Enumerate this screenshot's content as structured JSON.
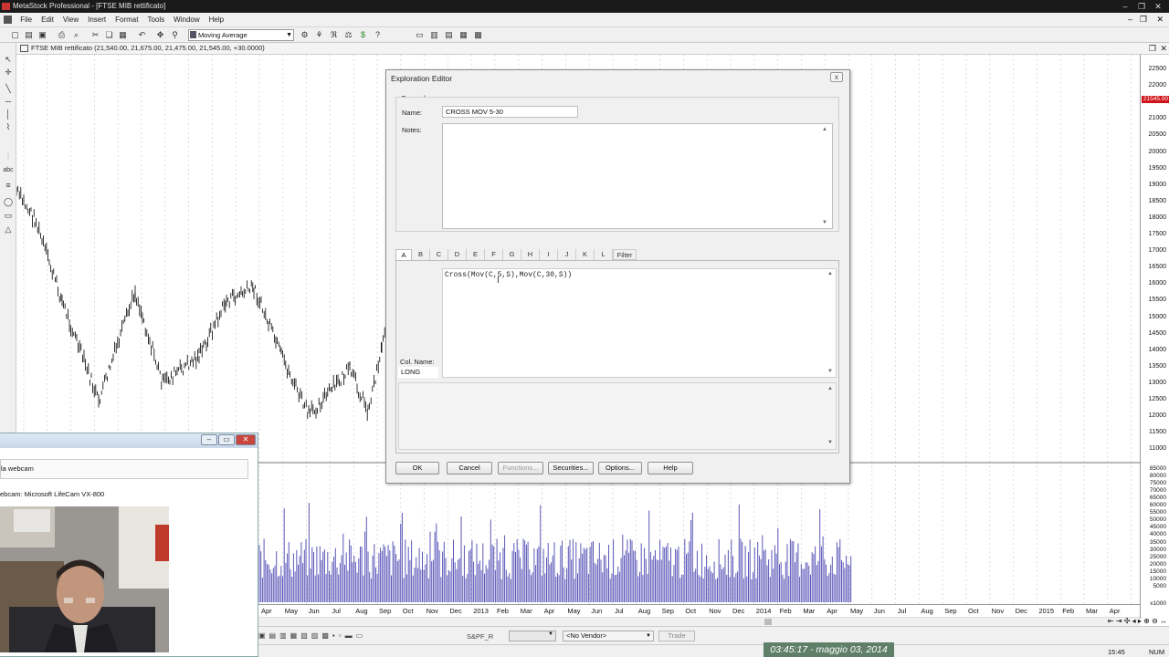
{
  "window": {
    "title": "MetaStock Professional - [FTSE MIB rettificato]"
  },
  "menu": [
    "File",
    "Edit",
    "View",
    "Insert",
    "Format",
    "Tools",
    "Window",
    "Help"
  ],
  "toolbar": {
    "indicator_select": "Moving Average"
  },
  "chart_header": {
    "title": "FTSE MIB rettificato (21,540.00, 21,675.00, 21,475.00, 21,545.00, +30.0000)"
  },
  "price_axis": {
    "labels": [
      "22500",
      "22000",
      "21500",
      "21000",
      "20500",
      "20000",
      "19500",
      "19000",
      "18500",
      "18000",
      "17500",
      "17000",
      "16500",
      "16000",
      "15500",
      "15000",
      "14500",
      "14000",
      "13500",
      "13000",
      "12500",
      "12000",
      "11500",
      "11000"
    ],
    "current_price": "21545.00",
    "volume_labels": [
      "85000",
      "80000",
      "75000",
      "70000",
      "65000",
      "60000",
      "55000",
      "50000",
      "45000",
      "40000",
      "35000",
      "30000",
      "25000",
      "20000",
      "15000",
      "10000",
      "5000"
    ],
    "volume_unit": "x1000"
  },
  "time_axis": {
    "labels": [
      "Apr",
      "May",
      "Jun",
      "Jul",
      "Aug",
      "Sep",
      "Oct",
      "Nov",
      "Dec",
      "2013",
      "Feb",
      "Mar",
      "Apr",
      "May",
      "Jun",
      "Jul",
      "Aug",
      "Sep",
      "Oct",
      "Nov",
      "Dec",
      "2014",
      "Feb",
      "Mar",
      "Apr",
      "May",
      "Jun",
      "Jul",
      "Aug",
      "Sep",
      "Oct",
      "Nov",
      "Dec",
      "2015",
      "Feb",
      "Mar",
      "Apr"
    ]
  },
  "dialog": {
    "title": "Exploration Editor",
    "close": "x",
    "group_label": "General",
    "name_label": "Name:",
    "name_value": "CROSS MOV 5-30",
    "notes_label": "Notes:",
    "notes_value": "",
    "tabs": [
      "A",
      "B",
      "C",
      "D",
      "E",
      "F",
      "G",
      "H",
      "I",
      "J",
      "K",
      "L",
      "Filter"
    ],
    "formula": "Cross(Mov(C,5,S),Mov(C,30,S))",
    "col_name_label": "Col. Name:",
    "col_name_value": "LONG",
    "buttons": {
      "ok": "OK",
      "cancel": "Cancel",
      "functions": "Functions...",
      "securities": "Securities...",
      "options": "Options...",
      "help": "Help"
    }
  },
  "webcam": {
    "line1": "la webcam",
    "camera_label": "ebcam:  Microsoft LifeCam VX-800"
  },
  "bottom": {
    "security": "S&PF_R",
    "vendor": "<No Vendor>",
    "trade": "Trade",
    "time": "15:45",
    "num": "NUM"
  },
  "overlay_clock": "03:45:17 - maggio 03, 2014"
}
